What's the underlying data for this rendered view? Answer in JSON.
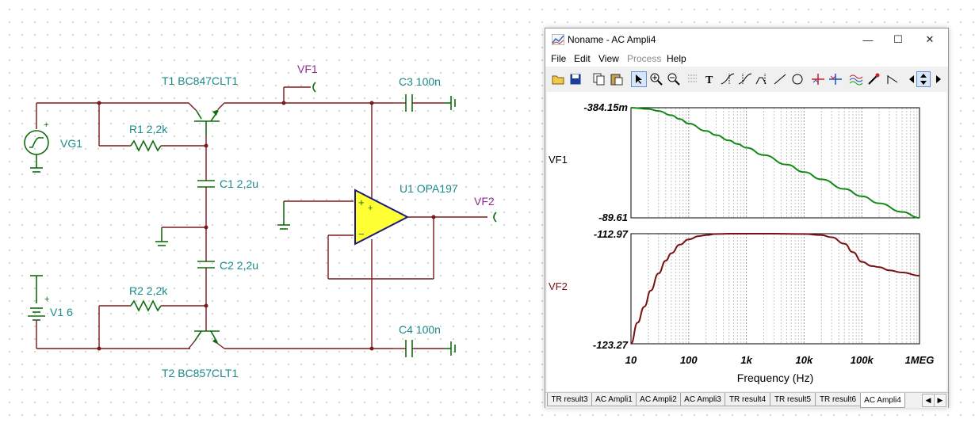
{
  "schematic": {
    "labels": {
      "t1": "T1 BC847CLT1",
      "t2": "T2 BC857CLT1",
      "r1": "R1 2,2k",
      "r2": "R2 2,2k",
      "c1": "C1 2,2u",
      "c2": "C2 2,2u",
      "c3": "C3 100n",
      "c4": "C4 100n",
      "u1": "U1 OPA197",
      "vg1": "VG1",
      "v1": "V1 6",
      "vf1": "VF1",
      "vf2": "VF2"
    },
    "colors": {
      "wire": "#7a1a1a",
      "component": "#0f6d0f",
      "label": "#1a8a8a",
      "probe": "#8e2b8e",
      "opamp_fill": "#ffff33"
    }
  },
  "window": {
    "title": "Noname - AC Ampli4",
    "controls": {
      "minimize": "—",
      "maximize": "☐",
      "close": "✕"
    },
    "menu": [
      {
        "label": "File",
        "enabled": true
      },
      {
        "label": "Edit",
        "enabled": true
      },
      {
        "label": "View",
        "enabled": true
      },
      {
        "label": "Process",
        "enabled": false
      },
      {
        "label": "Help",
        "enabled": true
      }
    ],
    "toolbar_icons": [
      "open-icon",
      "save-icon",
      "copy-icon",
      "paste-icon",
      "pointer-icon",
      "zoom-in-icon",
      "zoom-out-icon",
      "grid-icon",
      "text-icon",
      "cursor-a-icon",
      "cursor-b-icon",
      "cursor-c-icon",
      "line-icon",
      "circle-icon",
      "marker-a-icon",
      "marker-b-icon",
      "curves-icon",
      "probe-icon",
      "step-icon"
    ],
    "tabs": [
      {
        "label": "TR result3",
        "active": false
      },
      {
        "label": "AC Ampli1",
        "active": false
      },
      {
        "label": "AC Ampli2",
        "active": false
      },
      {
        "label": "AC Ampli3",
        "active": false
      },
      {
        "label": "TR result4",
        "active": false
      },
      {
        "label": "TR result5",
        "active": false
      },
      {
        "label": "TR result6",
        "active": false
      },
      {
        "label": "AC Ampli4",
        "active": true
      }
    ]
  },
  "chart_data": [
    {
      "type": "line",
      "ylabel": "VF1",
      "ytick_labels": [
        "-384.15m",
        "-89.61"
      ],
      "ylim": [
        -89.61,
        -0.38415
      ],
      "x_scale": "log",
      "xlim": [
        10,
        1000000
      ],
      "color": "#138a13",
      "series": [
        {
          "x": [
            10,
            20,
            30,
            50,
            70,
            100,
            200,
            300,
            500,
            700,
            1000,
            2000,
            5000,
            10000,
            20000,
            50000,
            100000,
            200000,
            500000,
            1000000
          ],
          "values": [
            -0.38,
            -1.4,
            -3.0,
            -6.5,
            -9.5,
            -13.2,
            -19.2,
            -22.6,
            -26.9,
            -29.8,
            -32.8,
            -38.7,
            -46.5,
            -52.5,
            -58.4,
            -66.2,
            -72.1,
            -77.8,
            -84.8,
            -89.61
          ]
        }
      ]
    },
    {
      "type": "line",
      "ylabel": "VF2",
      "ytick_labels": [
        "-112.97",
        "-123.27"
      ],
      "ylim": [
        -123.27,
        -112.97
      ],
      "x_scale": "log",
      "xlim": [
        10,
        1000000
      ],
      "xlabel": "Frequency (Hz)",
      "xtick_labels": [
        "10",
        "100",
        "1k",
        "10k",
        "100k",
        "1MEG"
      ],
      "color": "#7a1111",
      "series": [
        {
          "x": [
            10,
            13,
            17,
            22,
            30,
            40,
            50,
            70,
            100,
            150,
            200,
            300,
            500,
            1000,
            3000,
            10000,
            20000,
            30000,
            50000,
            70000,
            100000,
            150000,
            200000,
            300000,
            500000,
            1000000
          ],
          "values": [
            -123.27,
            -121.3,
            -119.8,
            -118.3,
            -116.7,
            -115.5,
            -114.8,
            -114.0,
            -113.5,
            -113.2,
            -113.1,
            -113.0,
            -112.97,
            -112.97,
            -112.97,
            -113.0,
            -113.1,
            -113.3,
            -113.9,
            -114.7,
            -115.6,
            -116.0,
            -116.1,
            -116.4,
            -116.6,
            -116.9
          ]
        }
      ]
    }
  ]
}
